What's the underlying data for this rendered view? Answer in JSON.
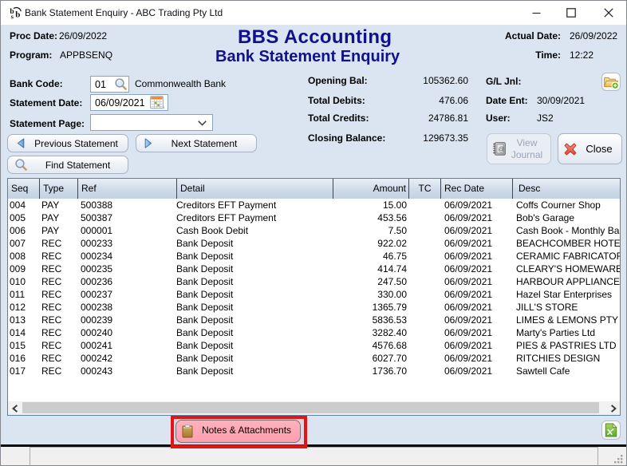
{
  "window": {
    "title": "Bank Statement Enquiry - ABC Trading Pty Ltd"
  },
  "header": {
    "proc_date_label": "Proc Date:",
    "proc_date": "26/09/2022",
    "program_label": "Program:",
    "program": "APPBSENQ",
    "app_title": "BBS Accounting",
    "screen_title": "Bank Statement Enquiry",
    "actual_date_label": "Actual Date:",
    "actual_date": "26/09/2022",
    "time_label": "Time:",
    "time": "12:22"
  },
  "form": {
    "bank_code_label": "Bank Code:",
    "bank_code": "01",
    "bank_name": "Commonwealth Bank",
    "statement_date_label": "Statement Date:",
    "statement_date": "06/09/2021",
    "statement_page_label": "Statement Page:",
    "statement_page": "",
    "prev_button": "Previous Statement",
    "next_button": "Next Statement",
    "find_button": "Find Statement"
  },
  "summary": {
    "opening_bal_label": "Opening Bal:",
    "opening_bal": "105362.60",
    "total_debits_label": "Total Debits:",
    "total_debits": "476.06",
    "total_credits_label": "Total Credits:",
    "total_credits": "24786.81",
    "closing_balance_label": "Closing Balance:",
    "closing_balance": "129673.35",
    "gl_jnl_label": "G/L Jnl:",
    "date_ent_label": "Date Ent:",
    "date_ent": "30/09/2021",
    "user_label": "User:",
    "user": "JS2",
    "view_journal_button": "View Journal",
    "close_button": "Close"
  },
  "table": {
    "columns": [
      "Seq",
      "Type",
      "Ref",
      "Detail",
      "Amount",
      "TC",
      "Rec Date",
      "Desc"
    ],
    "rows": [
      {
        "seq": "004",
        "type": "PAY",
        "ref": "500388",
        "detail": "Creditors EFT Payment",
        "amount": "15.00",
        "tc": "",
        "rec_date": "06/09/2021",
        "desc": "Coffs Courner Shop"
      },
      {
        "seq": "005",
        "type": "PAY",
        "ref": "500387",
        "detail": "Creditors EFT Payment",
        "amount": "453.56",
        "tc": "",
        "rec_date": "06/09/2021",
        "desc": "Bob's Garage"
      },
      {
        "seq": "006",
        "type": "PAY",
        "ref": "000001",
        "detail": "Cash Book Debit",
        "amount": "7.50",
        "tc": "",
        "rec_date": "06/09/2021",
        "desc": "Cash Book - Monthly Bank Fees"
      },
      {
        "seq": "007",
        "type": "REC",
        "ref": "000233",
        "detail": "Bank Deposit",
        "amount": "922.02",
        "tc": "",
        "rec_date": "06/09/2021",
        "desc": "BEACHCOMBER HOTELS"
      },
      {
        "seq": "008",
        "type": "REC",
        "ref": "000234",
        "detail": "Bank Deposit",
        "amount": "46.75",
        "tc": "",
        "rec_date": "06/09/2021",
        "desc": "CERAMIC FABRICATORS"
      },
      {
        "seq": "009",
        "type": "REC",
        "ref": "000235",
        "detail": "Bank Deposit",
        "amount": "414.74",
        "tc": "",
        "rec_date": "06/09/2021",
        "desc": "CLEARY'S HOMEWARES"
      },
      {
        "seq": "010",
        "type": "REC",
        "ref": "000236",
        "detail": "Bank Deposit",
        "amount": "247.50",
        "tc": "",
        "rec_date": "06/09/2021",
        "desc": "HARBOUR APPLIANCES"
      },
      {
        "seq": "011",
        "type": "REC",
        "ref": "000237",
        "detail": "Bank Deposit",
        "amount": "330.00",
        "tc": "",
        "rec_date": "06/09/2021",
        "desc": "Hazel Star Enterprises"
      },
      {
        "seq": "012",
        "type": "REC",
        "ref": "000238",
        "detail": "Bank Deposit",
        "amount": "1365.79",
        "tc": "",
        "rec_date": "06/09/2021",
        "desc": "JILL'S STORE"
      },
      {
        "seq": "013",
        "type": "REC",
        "ref": "000239",
        "detail": "Bank Deposit",
        "amount": "5836.53",
        "tc": "",
        "rec_date": "06/09/2021",
        "desc": "LIMES & LEMONS PTY LTD"
      },
      {
        "seq": "014",
        "type": "REC",
        "ref": "000240",
        "detail": "Bank Deposit",
        "amount": "3282.40",
        "tc": "",
        "rec_date": "06/09/2021",
        "desc": "Marty's Parties Ltd"
      },
      {
        "seq": "015",
        "type": "REC",
        "ref": "000241",
        "detail": "Bank Deposit",
        "amount": "4576.68",
        "tc": "",
        "rec_date": "06/09/2021",
        "desc": "PIES & PASTRIES LTD"
      },
      {
        "seq": "016",
        "type": "REC",
        "ref": "000242",
        "detail": "Bank Deposit",
        "amount": "6027.70",
        "tc": "",
        "rec_date": "06/09/2021",
        "desc": "RITCHIES DESIGN"
      },
      {
        "seq": "017",
        "type": "REC",
        "ref": "000243",
        "detail": "Bank Deposit",
        "amount": "1736.70",
        "tc": "",
        "rec_date": "06/09/2021",
        "desc": "Sawtell Cafe"
      }
    ]
  },
  "footer": {
    "notes_button": "Notes & Attachments"
  },
  "icons": {
    "app_logo": "bbs-logo",
    "bank_code_lookup": "magnifier-icon",
    "statement_date_picker": "calendar-icon",
    "statement_page_dropdown": "chevron-down-icon",
    "prev": "arrow-left-icon",
    "next": "arrow-right-icon",
    "find": "magnifier-icon",
    "gl_jnl": "folder-plus-icon",
    "view_journal": "journal-book-icon",
    "close": "red-cross-icon",
    "notes": "clipboard-icon",
    "excel_export": "excel-file-icon"
  },
  "colors": {
    "window_bg": "#dbe4f1",
    "titlebar_bg": "#ffffff",
    "heading_navy": "#11118b",
    "grid_border": "#5d81a6",
    "grid_header_top": "#e9eff7",
    "grid_header_bottom": "#c3d2e4",
    "highlight_red": "#e21414",
    "highlight_pink": "#ffa0ae",
    "status_bg": "#f0f0f0"
  }
}
